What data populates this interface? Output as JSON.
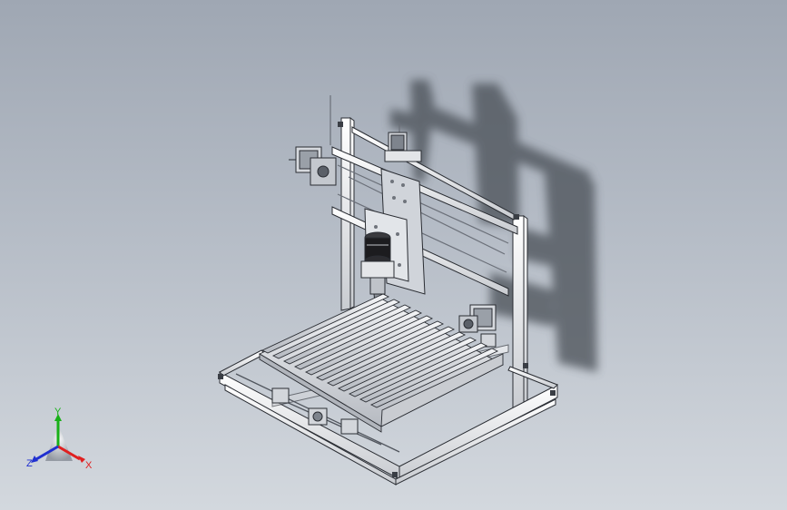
{
  "viewport": {
    "background_top": "#9fa7b3",
    "background_bottom": "#d3d8de"
  },
  "model": {
    "frame_color": "#e8eaed",
    "outline_color": "#2a2d33",
    "shadow_color": "#4a4f57",
    "spindle_color": "#1c1c1f"
  },
  "triad": {
    "x_label": "X",
    "y_label": "Y",
    "z_label": "Z",
    "x_color": "#e02020",
    "y_color": "#18b018",
    "z_color": "#2030d0"
  }
}
